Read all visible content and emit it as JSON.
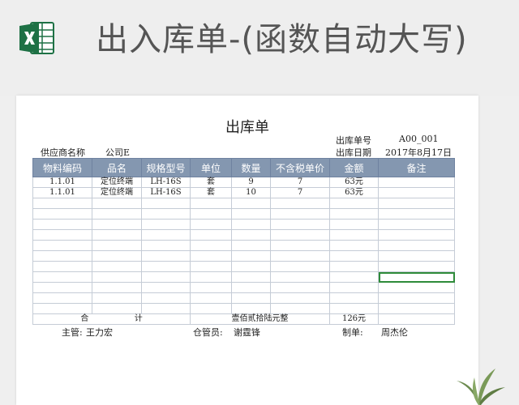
{
  "banner": {
    "title": "出入库单-(函数自动大写)",
    "logo_icon": "excel-icon"
  },
  "doc": {
    "title": "出库单",
    "supplier_label": "供应商名称",
    "supplier_value": "公司E",
    "order_no_label": "出库单号",
    "order_no_value": "A00_001",
    "date_label": "出库日期",
    "date_value": "2017年8月17日"
  },
  "table": {
    "headers": [
      "物料编码",
      "品名",
      "规格型号",
      "单位",
      "数量",
      "不含税单价",
      "金额",
      "备注"
    ],
    "rows": [
      [
        "1.1.01",
        "定位终端",
        "LH-16S",
        "套",
        "9",
        "7",
        "63元",
        ""
      ],
      [
        "1.1.01",
        "定位终端",
        "LH-16S",
        "套",
        "10",
        "7",
        "63元",
        ""
      ]
    ],
    "total_label_1": "合",
    "total_label_2": "计",
    "total_upper": "壹佰贰拾陆元整",
    "total_amount": "126元"
  },
  "footer": {
    "supervisor_label": "主管:",
    "supervisor_value": "王力宏",
    "keeper_label": "仓管员:",
    "keeper_value": "谢霆锋",
    "maker_label": "制单:",
    "maker_value": "周杰伦"
  },
  "colors": {
    "header_bg": "#8497b0",
    "excel_green": "#1e7145",
    "selection": "#2e8b3a"
  }
}
